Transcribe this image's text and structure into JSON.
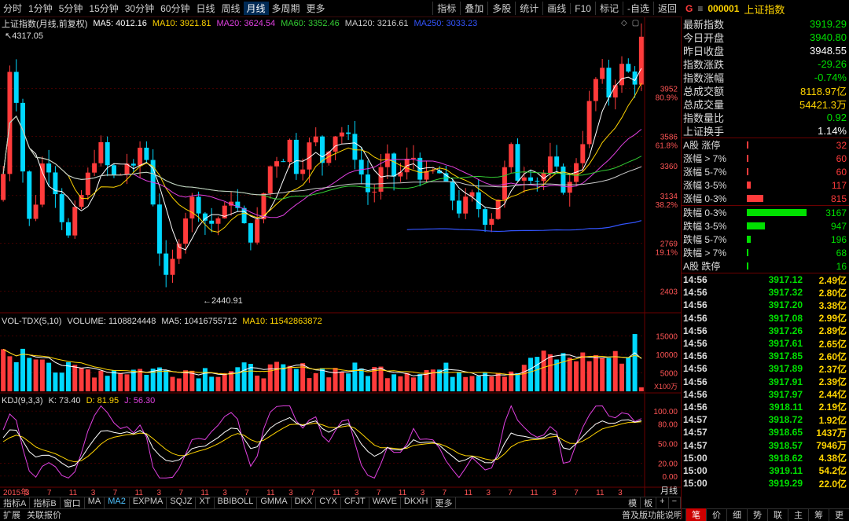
{
  "toolbar": {
    "timeframes": [
      "分时",
      "1分钟",
      "5分钟",
      "15分钟",
      "30分钟",
      "60分钟",
      "日线",
      "周线",
      "月线",
      "多周期",
      "更多"
    ],
    "active_timeframe": "月线",
    "tools": [
      "指标",
      "叠加",
      "多股",
      "统计",
      "画线",
      "F10",
      "标记",
      "-自选",
      "返回"
    ]
  },
  "header": {
    "badge": "G",
    "code": "000001",
    "name": "上证指数"
  },
  "main_legend": {
    "title": "上证指数(月线,前复权)",
    "items": [
      {
        "label": "MA5: 4012.16",
        "color": "#ffffff"
      },
      {
        "label": "MA10: 3921.81",
        "color": "#ffd400"
      },
      {
        "label": "MA20: 3624.54",
        "color": "#e040e0"
      },
      {
        "label": "MA60: 3352.46",
        "color": "#33cc33"
      },
      {
        "label": "MA120: 3216.61",
        "color": "#cccccc"
      },
      {
        "label": "MA250: 3033.23",
        "color": "#3355ff"
      }
    ]
  },
  "price_axis": {
    "labels": [
      "3952",
      "3586",
      "3360",
      "3134",
      "2769",
      "2403"
    ],
    "pct_labels": [
      "80.9%",
      "61.8%",
      "38.2%",
      "19.1%"
    ],
    "high_label": "4317.05",
    "low_label": "2440.91"
  },
  "volume_legend": {
    "title": "VOL-TDX(5,10)",
    "items": [
      {
        "label": "VOLUME: 1108824448",
        "color": "#dddddd"
      },
      {
        "label": "MA5: 10416755712",
        "color": "#dddddd"
      },
      {
        "label": "MA10: 11542863872",
        "color": "#ffd400"
      }
    ],
    "axis": [
      "15000",
      "10000",
      "5000"
    ],
    "unit": "X100万"
  },
  "kdj_legend": {
    "title": "KDJ(9,3,3)",
    "items": [
      {
        "label": "K: 73.40",
        "color": "#dddddd"
      },
      {
        "label": "D: 81.95",
        "color": "#ffd400"
      },
      {
        "label": "J: 56.30",
        "color": "#e040e0"
      }
    ],
    "axis": [
      "100.00",
      "80.00",
      "50.00",
      "20.00",
      "0.00"
    ]
  },
  "time_axis": {
    "labels": [
      "2015年",
      "3",
      "7",
      "11",
      "3",
      "7",
      "11",
      "3",
      "7",
      "11",
      "3",
      "7",
      "11",
      "3",
      "7",
      "11",
      "3",
      "7",
      "11",
      "3",
      "7",
      "11",
      "3",
      "7",
      "11",
      "3",
      "7",
      "11",
      "3"
    ],
    "period": "月线"
  },
  "indicator_tabs": {
    "items": [
      "指标A",
      "指标B",
      "窗口",
      "MA",
      "MA2",
      "EXPMA",
      "SQJZ",
      "XT",
      "BBIBOLL",
      "GMMA",
      "DKX",
      "CYX",
      "CFJT",
      "WAVE",
      "DKXH",
      "更多"
    ],
    "active": "MA2",
    "right_controls": [
      "模",
      "板",
      "+",
      "−"
    ]
  },
  "status_bar": {
    "left": [
      "扩展",
      "关联报价"
    ],
    "mid": "普及版功能说明",
    "right_tabs": [
      "笔",
      "价",
      "细",
      "势",
      "联",
      "主",
      "筹",
      "更"
    ],
    "active_tab": "笔"
  },
  "quote": [
    {
      "k": "最新指数",
      "v": "3919.29",
      "c": "#00e000"
    },
    {
      "k": "今日开盘",
      "v": "3940.80",
      "c": "#00e000"
    },
    {
      "k": "昨日收盘",
      "v": "3948.55",
      "c": "#ffffff"
    },
    {
      "k": "指数涨跌",
      "v": "-29.26",
      "c": "#00e000"
    },
    {
      "k": "指数涨幅",
      "v": "-0.74%",
      "c": "#00e000"
    },
    {
      "k": "总成交额",
      "v": "8118.97亿",
      "c": "#ffd400"
    },
    {
      "k": "总成交量",
      "v": "54421.3万",
      "c": "#ffd400"
    },
    {
      "k": "指数量比",
      "v": "0.92",
      "c": "#00e000"
    },
    {
      "k": "上证换手",
      "v": "1.14%",
      "c": "#ffffff"
    }
  ],
  "up_dist": [
    {
      "k": "A股 涨停",
      "v": "32",
      "level": 0.01
    },
    {
      "k": "涨幅 > 7%",
      "v": "60",
      "level": 0.02
    },
    {
      "k": "涨幅 5-7%",
      "v": "60",
      "level": 0.02
    },
    {
      "k": "涨幅 3-5%",
      "v": "117",
      "level": 0.06
    },
    {
      "k": "涨幅 0-3%",
      "v": "815",
      "level": 0.27
    }
  ],
  "down_dist": [
    {
      "k": "跌幅 0-3%",
      "v": "3167",
      "level": 1.0
    },
    {
      "k": "跌幅 3-5%",
      "v": "947",
      "level": 0.3
    },
    {
      "k": "跌幅 5-7%",
      "v": "196",
      "level": 0.07
    },
    {
      "k": "跌幅 > 7%",
      "v": "68",
      "level": 0.02
    },
    {
      "k": "A股 跌停",
      "v": "16",
      "level": 0.01
    }
  ],
  "ticks": [
    {
      "t": "14:56",
      "p": "3917.12",
      "q": "2.49亿"
    },
    {
      "t": "14:56",
      "p": "3917.32",
      "q": "2.80亿"
    },
    {
      "t": "14:56",
      "p": "3917.20",
      "q": "3.38亿"
    },
    {
      "t": "14:56",
      "p": "3917.08",
      "q": "2.99亿"
    },
    {
      "t": "14:56",
      "p": "3917.26",
      "q": "2.89亿"
    },
    {
      "t": "14:56",
      "p": "3917.61",
      "q": "2.65亿"
    },
    {
      "t": "14:56",
      "p": "3917.85",
      "q": "2.60亿"
    },
    {
      "t": "14:56",
      "p": "3917.89",
      "q": "2.37亿"
    },
    {
      "t": "14:56",
      "p": "3917.91",
      "q": "2.39亿"
    },
    {
      "t": "14:56",
      "p": "3917.97",
      "q": "2.44亿"
    },
    {
      "t": "14:56",
      "p": "3918.11",
      "q": "2.19亿"
    },
    {
      "t": "14:57",
      "p": "3918.72",
      "q": "1.92亿"
    },
    {
      "t": "14:57",
      "p": "3918.65",
      "q": "1437万"
    },
    {
      "t": "14:57",
      "p": "3918.57",
      "q": "7946万"
    },
    {
      "t": "15:00",
      "p": "3918.62",
      "q": "4.38亿"
    },
    {
      "t": "15:00",
      "p": "3919.11",
      "q": "54.2亿"
    },
    {
      "t": "15:00",
      "p": "3919.29",
      "q": "22.0亿"
    }
  ],
  "colors": {
    "up": "#ff3b3b",
    "down": "#00d8ff",
    "grid": "#6b0000"
  }
}
